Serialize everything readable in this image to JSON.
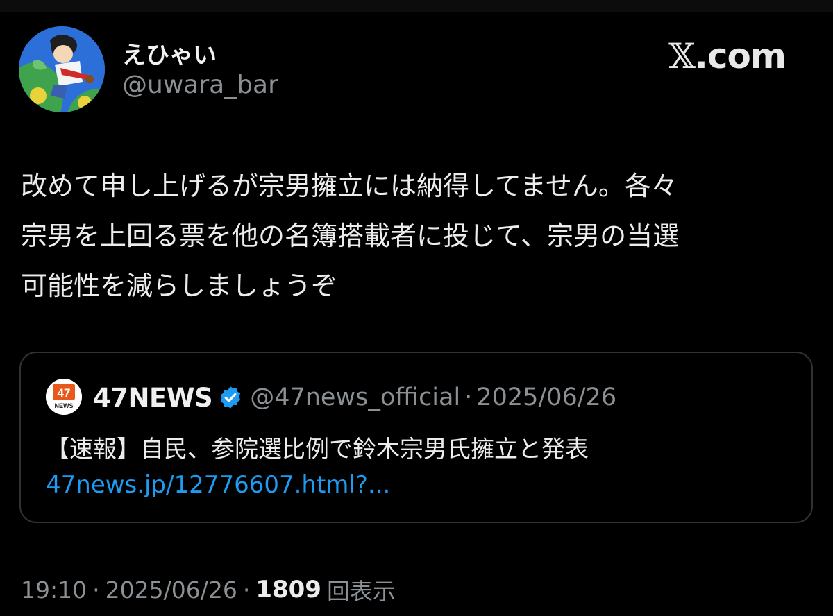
{
  "brand": {
    "x_glyph": "𝕏",
    "label": ".com"
  },
  "author": {
    "display_name": "えひゃい",
    "handle": "@uwara_bar",
    "avatar_icon": "avatar-illustration"
  },
  "tweet": {
    "lines": [
      "改めて申し上げるが宗男擁立には納得してません。各々",
      "宗男を上回る票を他の名簿搭載者に投じて、宗男の当選",
      "可能性を減らしましょうぞ"
    ]
  },
  "quote": {
    "logo_text": "47",
    "logo_subtext": "NEWS",
    "name": "47NEWS",
    "verified_icon": "verified-badge-icon",
    "handle": "@47news_official",
    "separator": "·",
    "date": "2025/06/26",
    "text": "【速報】自民、参院選比例で鈴木宗男氏擁立と発表",
    "link": "47news.jp/12776607.html?..."
  },
  "meta": {
    "time": "19:10",
    "separator": "·",
    "date": "2025/06/26",
    "views_count": "1809",
    "views_label": "回表示"
  },
  "colors": {
    "background": "#000000",
    "text_primary": "#ececec",
    "text_secondary": "#8b9095",
    "link": "#1d9bf0",
    "verified": "#1d9bf0",
    "card_border": "#2f3336"
  }
}
